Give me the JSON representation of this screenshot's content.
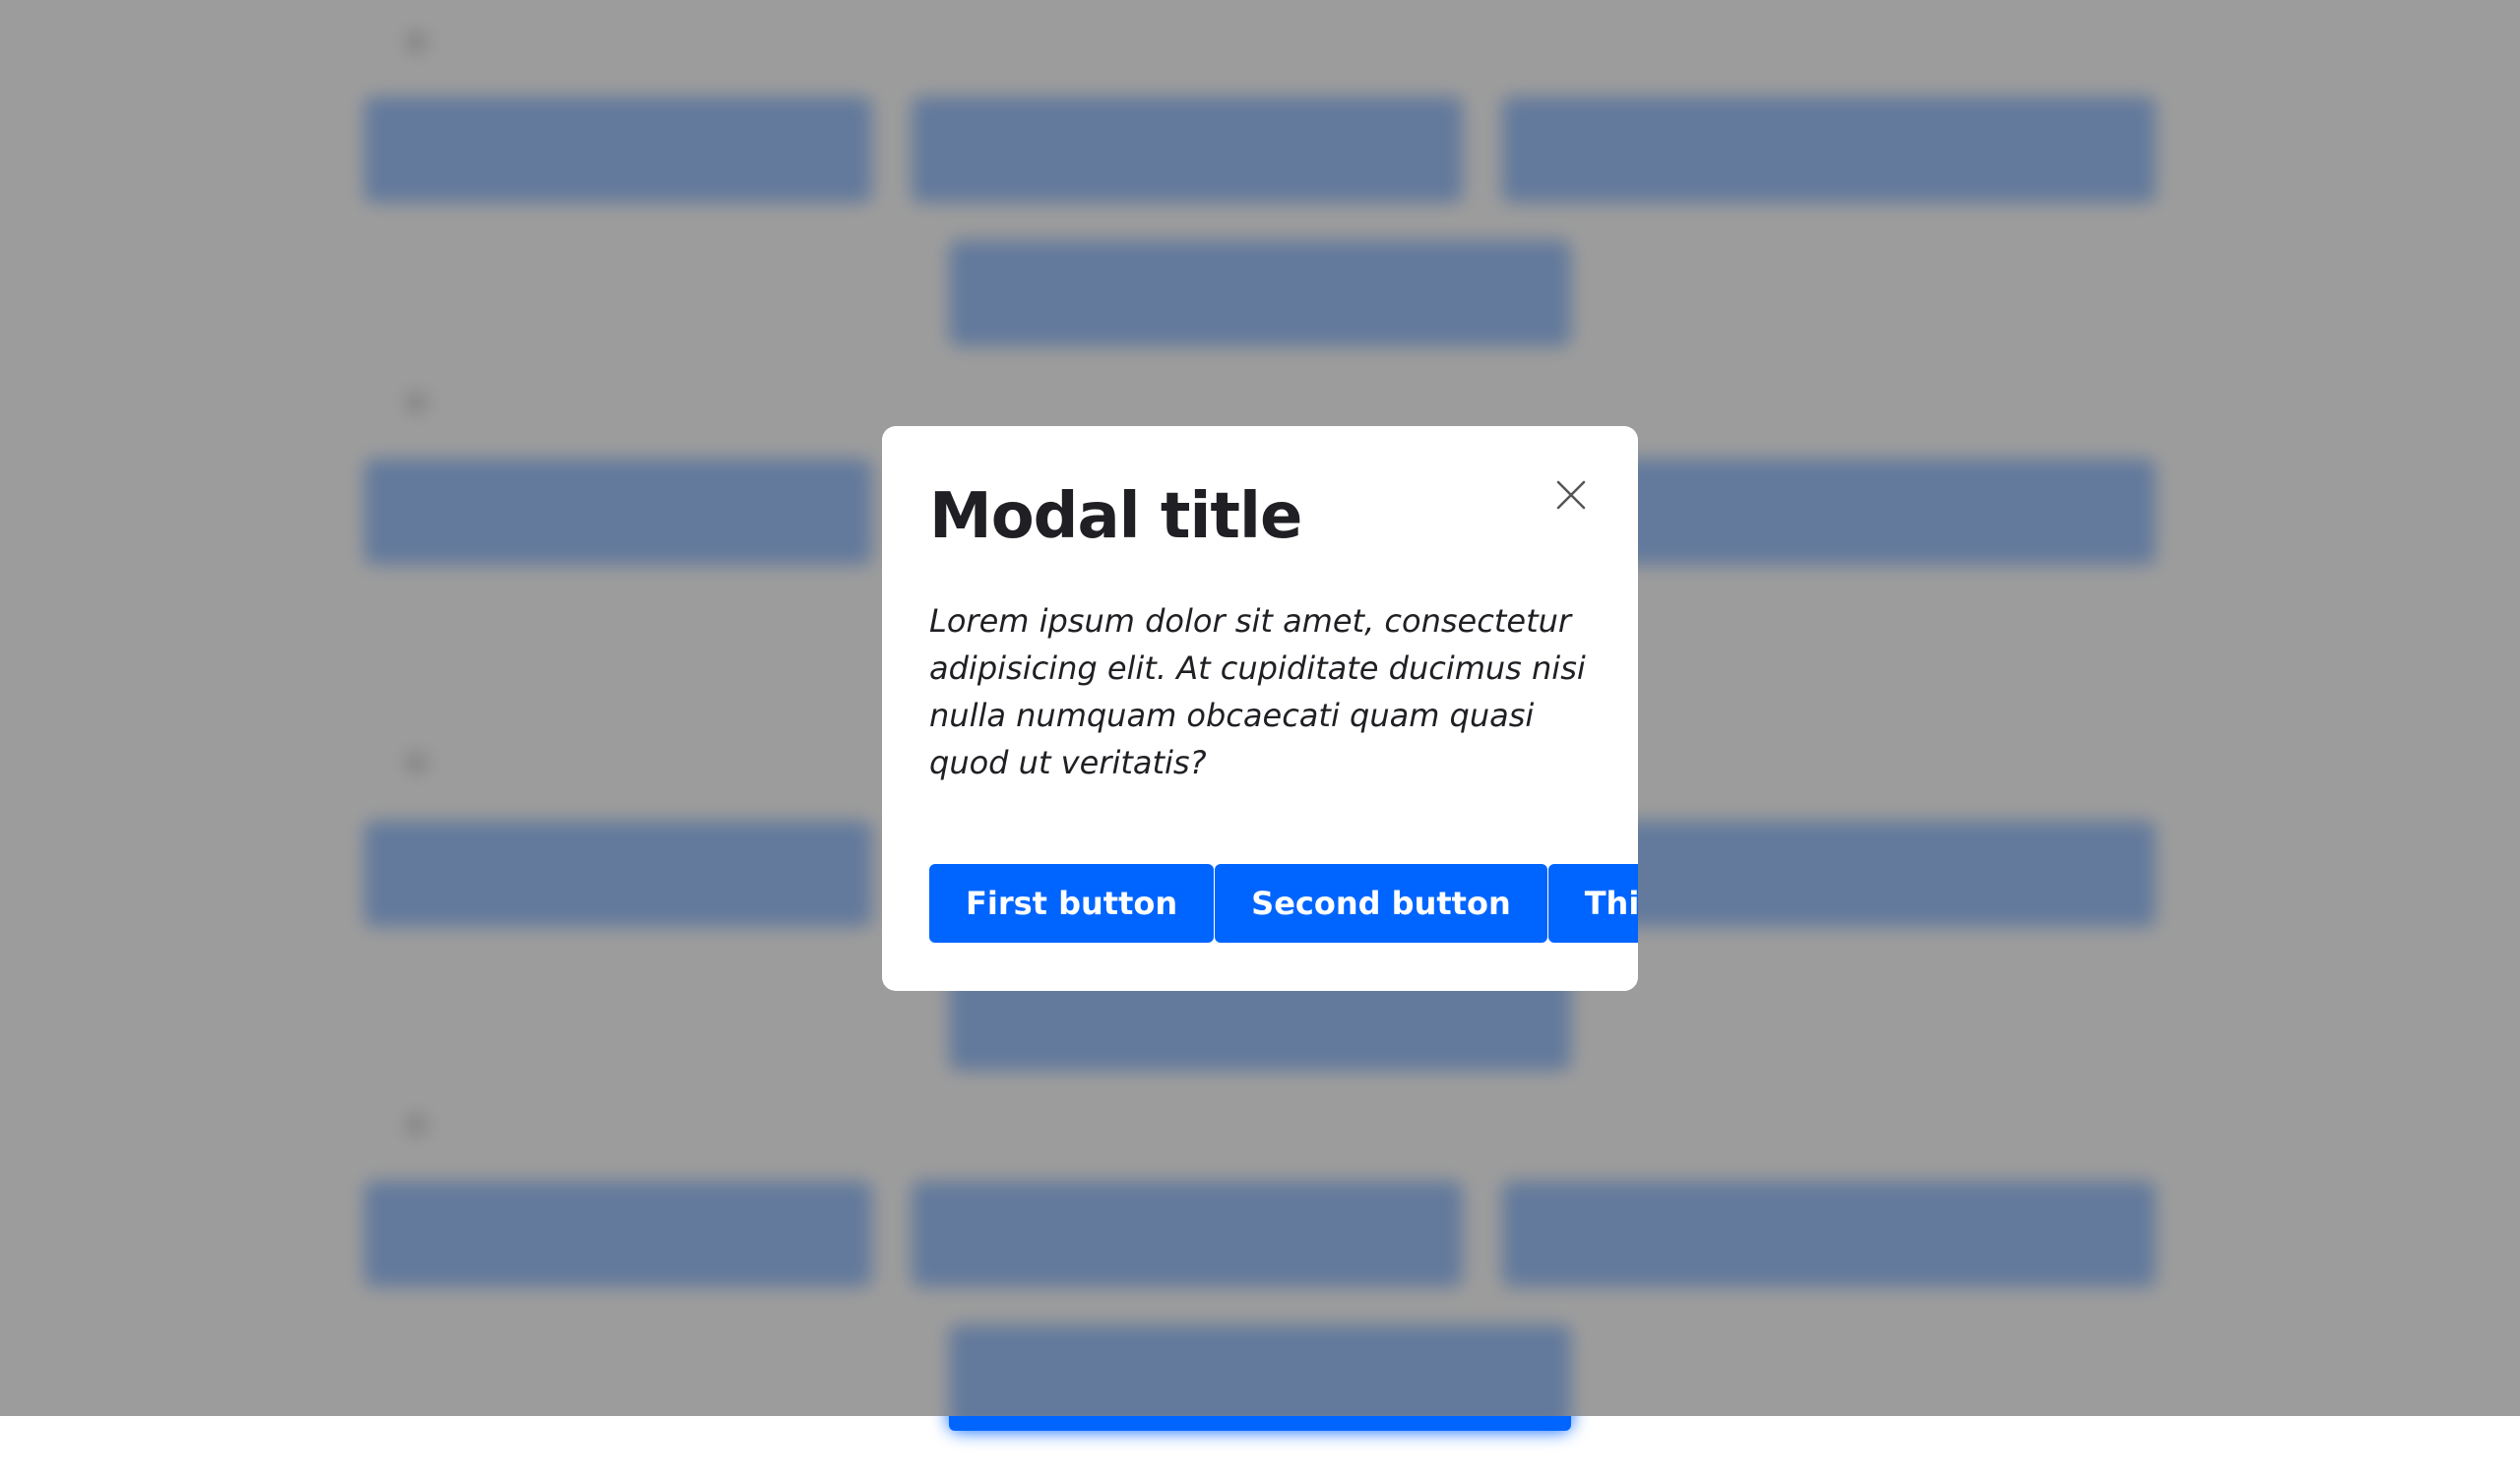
{
  "modal": {
    "title": "Modal title",
    "body": "Lorem ipsum dolor sit amet, consectetur adipisicing elit. At cupiditate ducimus nisi nulla numquam obcaecati quam quasi quod ut veritatis?",
    "buttons": [
      {
        "label": "First button"
      },
      {
        "label": "Second button"
      },
      {
        "label": "Third button"
      }
    ],
    "close_icon": "close-icon"
  },
  "colors": {
    "accent": "#0065ff",
    "overlay": "#808080",
    "modal_background": "#ffffff",
    "text": "#1f1f24"
  }
}
